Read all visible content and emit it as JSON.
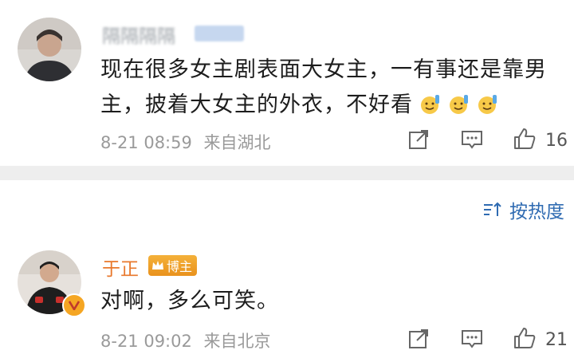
{
  "comments": [
    {
      "user_name": "隔隔隔隔",
      "user_badge": "",
      "content": "现在很多女主剧表面大女主，一有事还是靠男主，披着大女主的外衣，不好看",
      "emojis": [
        "hand-wave-emoji",
        "hand-wave-emoji",
        "hand-wave-emoji"
      ],
      "time": "8-21 08:59",
      "location": "来自湖北",
      "likes": "16"
    },
    {
      "user_name": "于正",
      "user_badge": "博主",
      "content": "对啊，多么可笑。",
      "time": "8-21 09:02",
      "location": "来自北京",
      "likes": "21"
    }
  ],
  "sort": {
    "label": "按热度"
  },
  "colors": {
    "accent_blue": "#2f6bb2",
    "author_orange": "#e8782c",
    "badge_gold": "#f5a623",
    "meta_gray": "#9a9a9a"
  }
}
